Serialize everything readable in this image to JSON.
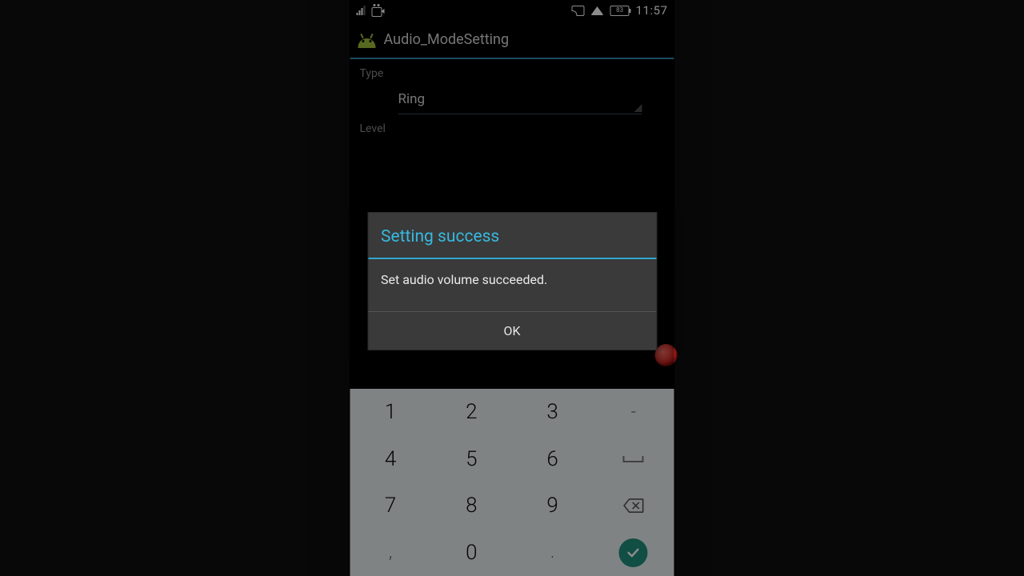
{
  "status": {
    "battery_pct": "83",
    "time": "11:57"
  },
  "appbar": {
    "title": "Audio_ModeSetting"
  },
  "form": {
    "type_label": "Type",
    "type_value": "Ring",
    "level_label": "Level"
  },
  "dialog": {
    "title": "Setting success",
    "message": "Set audio volume succeeded.",
    "ok": "OK"
  },
  "keypad": {
    "k1": "1",
    "k2": "2",
    "k3": "3",
    "kdash": "-",
    "k4": "4",
    "k5": "5",
    "k6": "6",
    "k7": "7",
    "k8": "8",
    "k9": "9",
    "kcomma": ",",
    "k0": "0",
    "kdot": "."
  }
}
